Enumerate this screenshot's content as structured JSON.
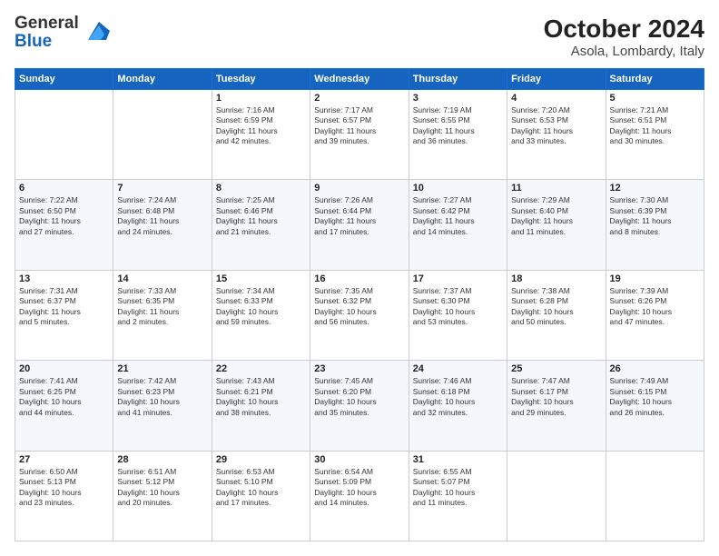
{
  "logo": {
    "line1": "General",
    "line2": "Blue"
  },
  "title": "October 2024",
  "subtitle": "Asola, Lombardy, Italy",
  "weekdays": [
    "Sunday",
    "Monday",
    "Tuesday",
    "Wednesday",
    "Thursday",
    "Friday",
    "Saturday"
  ],
  "weeks": [
    [
      {
        "day": "",
        "info": ""
      },
      {
        "day": "",
        "info": ""
      },
      {
        "day": "1",
        "info": "Sunrise: 7:16 AM\nSunset: 6:59 PM\nDaylight: 11 hours\nand 42 minutes."
      },
      {
        "day": "2",
        "info": "Sunrise: 7:17 AM\nSunset: 6:57 PM\nDaylight: 11 hours\nand 39 minutes."
      },
      {
        "day": "3",
        "info": "Sunrise: 7:19 AM\nSunset: 6:55 PM\nDaylight: 11 hours\nand 36 minutes."
      },
      {
        "day": "4",
        "info": "Sunrise: 7:20 AM\nSunset: 6:53 PM\nDaylight: 11 hours\nand 33 minutes."
      },
      {
        "day": "5",
        "info": "Sunrise: 7:21 AM\nSunset: 6:51 PM\nDaylight: 11 hours\nand 30 minutes."
      }
    ],
    [
      {
        "day": "6",
        "info": "Sunrise: 7:22 AM\nSunset: 6:50 PM\nDaylight: 11 hours\nand 27 minutes."
      },
      {
        "day": "7",
        "info": "Sunrise: 7:24 AM\nSunset: 6:48 PM\nDaylight: 11 hours\nand 24 minutes."
      },
      {
        "day": "8",
        "info": "Sunrise: 7:25 AM\nSunset: 6:46 PM\nDaylight: 11 hours\nand 21 minutes."
      },
      {
        "day": "9",
        "info": "Sunrise: 7:26 AM\nSunset: 6:44 PM\nDaylight: 11 hours\nand 17 minutes."
      },
      {
        "day": "10",
        "info": "Sunrise: 7:27 AM\nSunset: 6:42 PM\nDaylight: 11 hours\nand 14 minutes."
      },
      {
        "day": "11",
        "info": "Sunrise: 7:29 AM\nSunset: 6:40 PM\nDaylight: 11 hours\nand 11 minutes."
      },
      {
        "day": "12",
        "info": "Sunrise: 7:30 AM\nSunset: 6:39 PM\nDaylight: 11 hours\nand 8 minutes."
      }
    ],
    [
      {
        "day": "13",
        "info": "Sunrise: 7:31 AM\nSunset: 6:37 PM\nDaylight: 11 hours\nand 5 minutes."
      },
      {
        "day": "14",
        "info": "Sunrise: 7:33 AM\nSunset: 6:35 PM\nDaylight: 11 hours\nand 2 minutes."
      },
      {
        "day": "15",
        "info": "Sunrise: 7:34 AM\nSunset: 6:33 PM\nDaylight: 10 hours\nand 59 minutes."
      },
      {
        "day": "16",
        "info": "Sunrise: 7:35 AM\nSunset: 6:32 PM\nDaylight: 10 hours\nand 56 minutes."
      },
      {
        "day": "17",
        "info": "Sunrise: 7:37 AM\nSunset: 6:30 PM\nDaylight: 10 hours\nand 53 minutes."
      },
      {
        "day": "18",
        "info": "Sunrise: 7:38 AM\nSunset: 6:28 PM\nDaylight: 10 hours\nand 50 minutes."
      },
      {
        "day": "19",
        "info": "Sunrise: 7:39 AM\nSunset: 6:26 PM\nDaylight: 10 hours\nand 47 minutes."
      }
    ],
    [
      {
        "day": "20",
        "info": "Sunrise: 7:41 AM\nSunset: 6:25 PM\nDaylight: 10 hours\nand 44 minutes."
      },
      {
        "day": "21",
        "info": "Sunrise: 7:42 AM\nSunset: 6:23 PM\nDaylight: 10 hours\nand 41 minutes."
      },
      {
        "day": "22",
        "info": "Sunrise: 7:43 AM\nSunset: 6:21 PM\nDaylight: 10 hours\nand 38 minutes."
      },
      {
        "day": "23",
        "info": "Sunrise: 7:45 AM\nSunset: 6:20 PM\nDaylight: 10 hours\nand 35 minutes."
      },
      {
        "day": "24",
        "info": "Sunrise: 7:46 AM\nSunset: 6:18 PM\nDaylight: 10 hours\nand 32 minutes."
      },
      {
        "day": "25",
        "info": "Sunrise: 7:47 AM\nSunset: 6:17 PM\nDaylight: 10 hours\nand 29 minutes."
      },
      {
        "day": "26",
        "info": "Sunrise: 7:49 AM\nSunset: 6:15 PM\nDaylight: 10 hours\nand 26 minutes."
      }
    ],
    [
      {
        "day": "27",
        "info": "Sunrise: 6:50 AM\nSunset: 5:13 PM\nDaylight: 10 hours\nand 23 minutes."
      },
      {
        "day": "28",
        "info": "Sunrise: 6:51 AM\nSunset: 5:12 PM\nDaylight: 10 hours\nand 20 minutes."
      },
      {
        "day": "29",
        "info": "Sunrise: 6:53 AM\nSunset: 5:10 PM\nDaylight: 10 hours\nand 17 minutes."
      },
      {
        "day": "30",
        "info": "Sunrise: 6:54 AM\nSunset: 5:09 PM\nDaylight: 10 hours\nand 14 minutes."
      },
      {
        "day": "31",
        "info": "Sunrise: 6:55 AM\nSunset: 5:07 PM\nDaylight: 10 hours\nand 11 minutes."
      },
      {
        "day": "",
        "info": ""
      },
      {
        "day": "",
        "info": ""
      }
    ]
  ]
}
